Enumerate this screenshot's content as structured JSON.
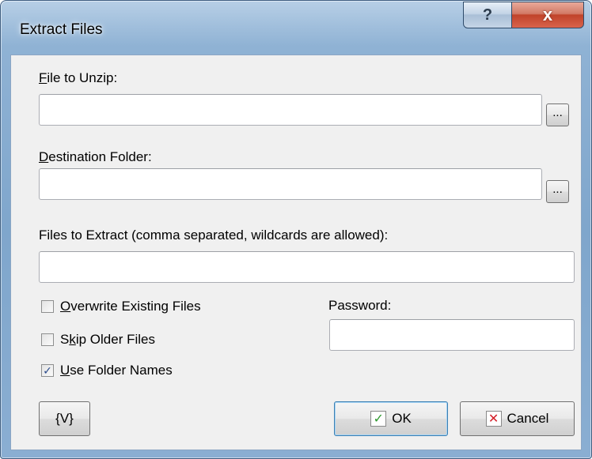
{
  "window": {
    "title": "Extract Files",
    "help_glyph": "?",
    "close_glyph": "x"
  },
  "form": {
    "file_to_unzip": {
      "label_accel": "F",
      "label_rest": "ile to Unzip:",
      "value": "",
      "browse_label": "..."
    },
    "destination_folder": {
      "label_accel": "D",
      "label_rest": "estination Folder:",
      "value": "",
      "browse_label": "..."
    },
    "files_to_extract": {
      "label": "Files to Extract (comma separated, wildcards are allowed):",
      "value": ""
    },
    "options": {
      "overwrite": {
        "accel": "O",
        "rest": "verwrite Existing Files",
        "checked": false
      },
      "skip_older": {
        "pre": "S",
        "accel": "k",
        "rest": "ip Older Files",
        "checked": false
      },
      "use_folder_names": {
        "accel": "U",
        "rest": "se Folder Names",
        "checked": true
      }
    },
    "password": {
      "label": "Password:",
      "value": ""
    }
  },
  "buttons": {
    "variables": "{V}",
    "ok": "OK",
    "cancel": "Cancel"
  },
  "icons": {
    "ok_icon": "check-icon",
    "cancel_icon": "x-icon",
    "check_glyph": "✓",
    "cross_glyph": "✕",
    "ok_color": "#2f9a2f",
    "cancel_color": "#d4202a"
  }
}
